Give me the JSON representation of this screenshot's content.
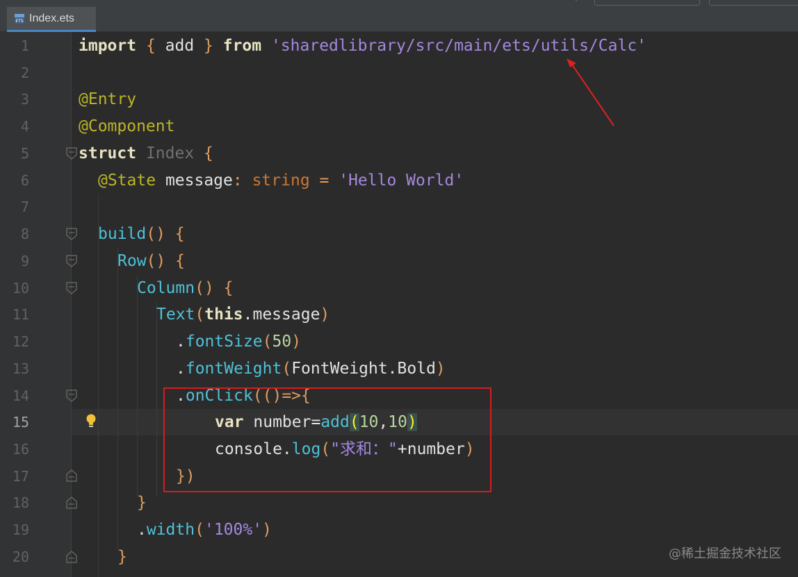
{
  "tab": {
    "label": "Index.ets",
    "icon": "ets-file-icon"
  },
  "colors": {
    "background": "#2b2b2b",
    "gutter": "#313335",
    "keyword": "#e8e3c3",
    "string": "#a587e0",
    "annotation": "#bbb529",
    "call": "#4fc1d8",
    "highlight_box": "#d11f1f"
  },
  "line_numbers": [
    "1",
    "2",
    "3",
    "4",
    "5",
    "6",
    "7",
    "8",
    "9",
    "10",
    "11",
    "12",
    "13",
    "14",
    "15",
    "16",
    "17",
    "18",
    "19",
    "20"
  ],
  "current_line": "15",
  "code": {
    "l1": {
      "k1": "import",
      "b1": " { ",
      "id": "add",
      "b2": " } ",
      "k2": "from",
      "s": " 'sharedlibrary/src/main/ets/utils/Calc'"
    },
    "l3": {
      "a": "@Entry"
    },
    "l4": {
      "a": "@Component"
    },
    "l5": {
      "k": "struct",
      "n": " Index",
      "b": " {"
    },
    "l6": {
      "a": "@State",
      "id": " message",
      "c": ": ",
      "t": "string",
      "e": " = ",
      "s": "'Hello World'"
    },
    "l8": {
      "f": "build",
      "p": "()",
      "b": " {"
    },
    "l9": {
      "f": "Row",
      "p": "()",
      "b": " {"
    },
    "l10": {
      "f": "Column",
      "p": "()",
      "b": " {"
    },
    "l11": {
      "f": "Text",
      "p1": "(",
      "k": "this",
      "r": ".message",
      "p2": ")"
    },
    "l12": {
      "d": ".",
      "f": "fontSize",
      "p1": "(",
      "n": "50",
      "p2": ")"
    },
    "l13": {
      "d": ".",
      "f": "fontWeight",
      "p1": "(",
      "r": "FontWeight.Bold",
      "p2": ")"
    },
    "l14": {
      "d": ".",
      "f": "onClick",
      "p": "(()=>{"
    },
    "l15": {
      "k": "var",
      "r": " number=",
      "f": "add",
      "p1": "(",
      "n1": "10",
      "c": ",",
      "n2": "10",
      "p2": ")"
    },
    "l16": {
      "r": "console.",
      "f": "log",
      "p1": "(",
      "s": "\"求和：\"",
      "r2": "+number",
      "p2": ")"
    },
    "l17": {
      "p": "})"
    },
    "l18": {
      "p": "}"
    },
    "l19": {
      "d": ".",
      "f": "width",
      "p1": "(",
      "s": "'100%'",
      "p2": ")"
    },
    "l20": {
      "p": "}"
    }
  },
  "watermark": "@稀土掘金技术社区"
}
